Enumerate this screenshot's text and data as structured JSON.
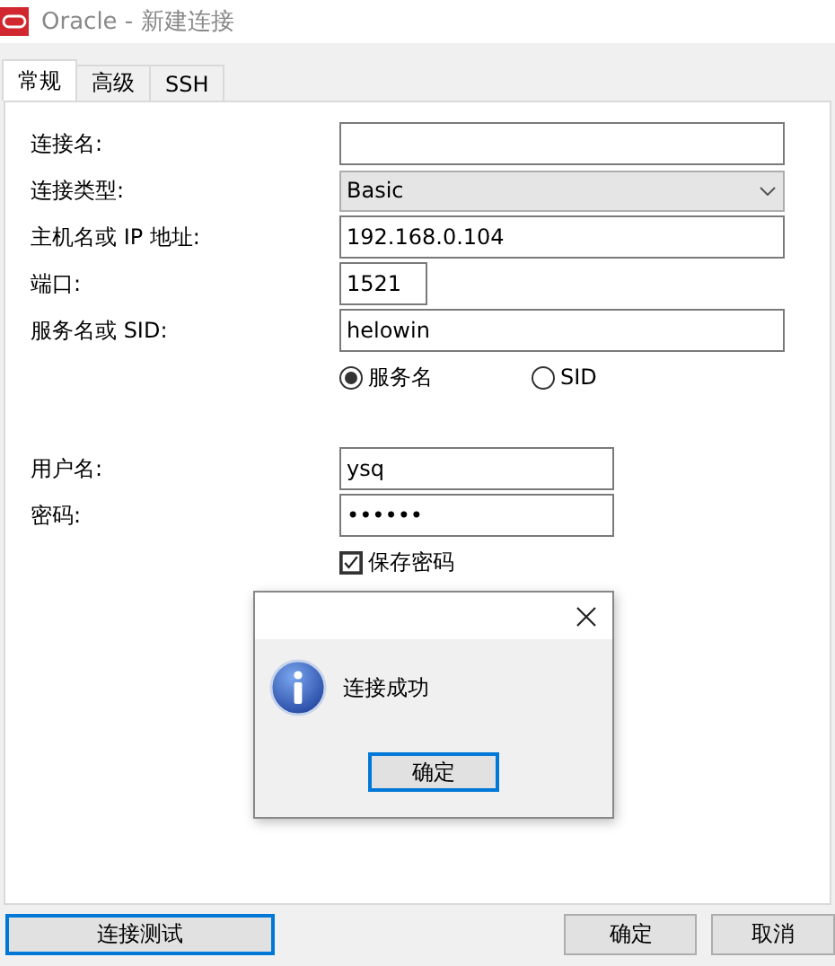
{
  "window": {
    "title": "Oracle - 新建连接"
  },
  "tabs": [
    {
      "label": "常规",
      "selected": true
    },
    {
      "label": "高级",
      "selected": false
    },
    {
      "label": "SSH",
      "selected": false
    }
  ],
  "sections": [
    {
      "rows": [
        {
          "kind": "text",
          "label": "连接名:"
        }
      ]
    },
    {
      "rows": [
        {
          "kind": "select",
          "label": "连接类型:",
          "value": "Basic"
        },
        {
          "kind": "text",
          "label": "主机名或 IP 地址:",
          "value": "192.168.0.104"
        },
        {
          "kind": "number",
          "label": "端口:",
          "value": "1521"
        },
        {
          "kind": "text",
          "label": "服务名或 SID:",
          "value": "helowin"
        },
        {
          "kind": "radio",
          "options": [
            {
              "label": "服务名",
              "selected": true
            },
            {
              "label": "SID",
              "selected": false
            }
          ]
        }
      ]
    },
    {
      "rows": [
        {
          "kind": "credential",
          "label": "用户名:",
          "value": "ysq"
        },
        {
          "kind": "credential",
          "label": "密码:",
          "value": "••••••"
        },
        {
          "kind": "checkbox",
          "label": "保存密码",
          "checked": true
        }
      ]
    }
  ],
  "dialog": {
    "message": "连接成功",
    "button": "确定"
  },
  "buttons": [
    {
      "label": "连接测试",
      "focused": true
    },
    {
      "label": "确定",
      "focused": false
    },
    {
      "label": "取消",
      "focused": false
    }
  ]
}
